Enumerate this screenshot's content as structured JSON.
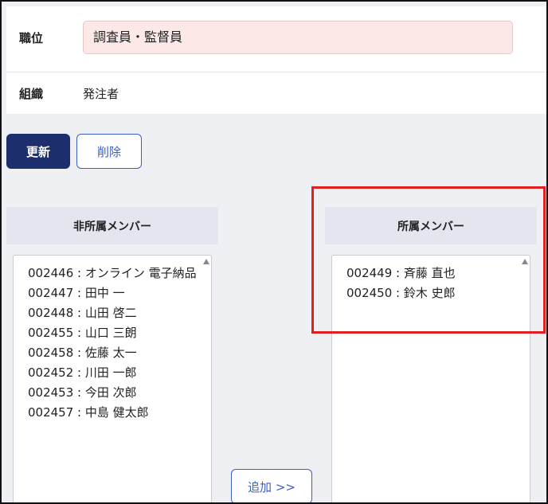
{
  "form": {
    "title_label": "職位",
    "title_value": "調査員・監督員",
    "org_label": "組織",
    "org_value": "発注者"
  },
  "actions": {
    "update_label": "更新",
    "delete_label": "削除",
    "add_label": "追加 >>"
  },
  "non_members": {
    "header": "非所属メンバー",
    "items": [
      "002446 : オンライン 電子納品",
      "002447 : 田中 一",
      "002448 : 山田 啓二",
      "002455 : 山口 三朗",
      "002458 : 佐藤 太一",
      "002452 : 川田 一郎",
      "002453 : 今田 次郎",
      "002457 : 中島 健太郎"
    ]
  },
  "members": {
    "header": "所属メンバー",
    "items": [
      "002449 : 斉藤 直也",
      "002450 : 鈴木 史郎"
    ]
  },
  "colors": {
    "primary": "#1c2e6b",
    "outline": "#3b5fc5",
    "highlight": "#e02020",
    "input_bg": "#fde8e8"
  }
}
